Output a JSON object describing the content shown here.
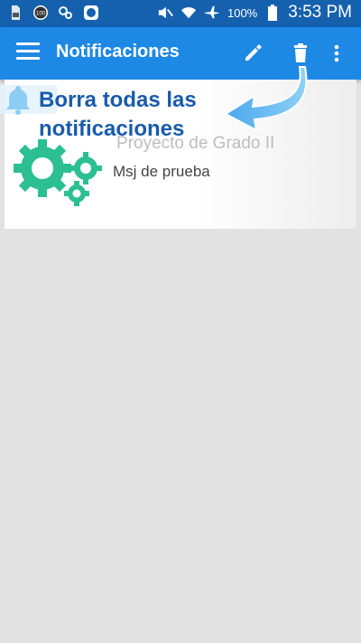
{
  "status_bar": {
    "left_icons": [
      "sd-card-icon",
      "badge-100-icon",
      "settings-sync-icon",
      "record-icon"
    ],
    "right_icons": [
      "mute-icon",
      "wifi-icon",
      "airplane-icon"
    ],
    "battery_percent": "100%",
    "time": "3:53 PM"
  },
  "app_bar": {
    "title": "Notificaciones",
    "actions": [
      "edit-icon",
      "delete-icon",
      "more-vert-icon"
    ]
  },
  "notification": {
    "title": "Proyecto de Grado II",
    "message": "Msj de prueba"
  },
  "callout": {
    "line1": "Borra todas las",
    "line2": "notificaciones"
  },
  "colors": {
    "status_bar": "#1561ae",
    "app_bar": "#1e88e5",
    "background": "#e2e2e2",
    "gear": "#2bbf93",
    "callout_text": "#1a5bab"
  }
}
